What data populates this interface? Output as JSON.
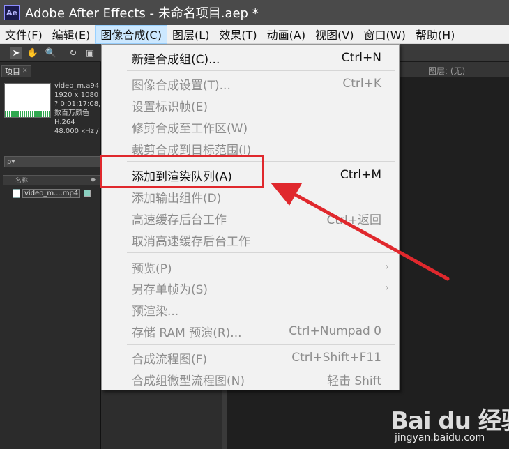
{
  "window": {
    "logo": "Ae",
    "title": "Adobe After Effects - 未命名项目.aep *"
  },
  "menubar": {
    "items": [
      {
        "label": "文件(F)"
      },
      {
        "label": "编辑(E)"
      },
      {
        "label": "图像合成(C)",
        "active": true
      },
      {
        "label": "图层(L)"
      },
      {
        "label": "效果(T)"
      },
      {
        "label": "动画(A)"
      },
      {
        "label": "视图(V)"
      },
      {
        "label": "窗口(W)"
      },
      {
        "label": "帮助(H)"
      }
    ]
  },
  "project_panel": {
    "tab_label": "项目",
    "meta": [
      "video_m.a94",
      "1920 x 1080 (",
      "? 0:01:17:08,",
      "数百万颜色",
      "H.264",
      "48.000 kHz /"
    ],
    "search_placeholder": "ρ▾",
    "column_name": "名称",
    "file_name": "video_m....mp4"
  },
  "comp_panel": {
    "layer_label": "图层: (无)"
  },
  "dropdown": {
    "items": [
      {
        "label": "新建合成组(C)...",
        "shortcut": "Ctrl+N",
        "enabled": true
      },
      {
        "label": "图像合成设置(T)...",
        "shortcut": "Ctrl+K",
        "enabled": false
      },
      {
        "label": "设置标识帧(E)",
        "shortcut": "",
        "enabled": false
      },
      {
        "label": "修剪合成至工作区(W)",
        "shortcut": "",
        "enabled": false
      },
      {
        "label": "裁剪合成到目标范围(I)",
        "shortcut": "",
        "enabled": false
      },
      {
        "label": "添加到渲染队列(A)",
        "shortcut": "Ctrl+M",
        "enabled": true
      },
      {
        "label": "添加输出组件(D)",
        "shortcut": "",
        "enabled": false
      },
      {
        "label": "高速缓存后台工作",
        "shortcut": "Ctrl+返回",
        "enabled": false
      },
      {
        "label": "取消高速缓存后台工作",
        "shortcut": "",
        "enabled": false
      },
      {
        "label": "预览(P)",
        "shortcut": "",
        "enabled": false,
        "submenu": true
      },
      {
        "label": "另存单帧为(S)",
        "shortcut": "",
        "enabled": false,
        "submenu": true
      },
      {
        "label": "预渲染...",
        "shortcut": "",
        "enabled": false
      },
      {
        "label": "存储 RAM 预演(R)...",
        "shortcut": "Ctrl+Numpad 0",
        "enabled": false
      },
      {
        "label": "合成流程图(F)",
        "shortcut": "Ctrl+Shift+F11",
        "enabled": false
      },
      {
        "label": "合成组微型流程图(N)",
        "shortcut": "轻击 Shift",
        "enabled": false
      }
    ]
  },
  "annotation": {
    "color": "#e0282d"
  },
  "watermark": {
    "logo": "Bai du 经验",
    "url": "jingyan.baidu.com"
  },
  "colors": {
    "menu_active_bg": "#cce8ff",
    "disabled_text": "#8d8d8d"
  }
}
